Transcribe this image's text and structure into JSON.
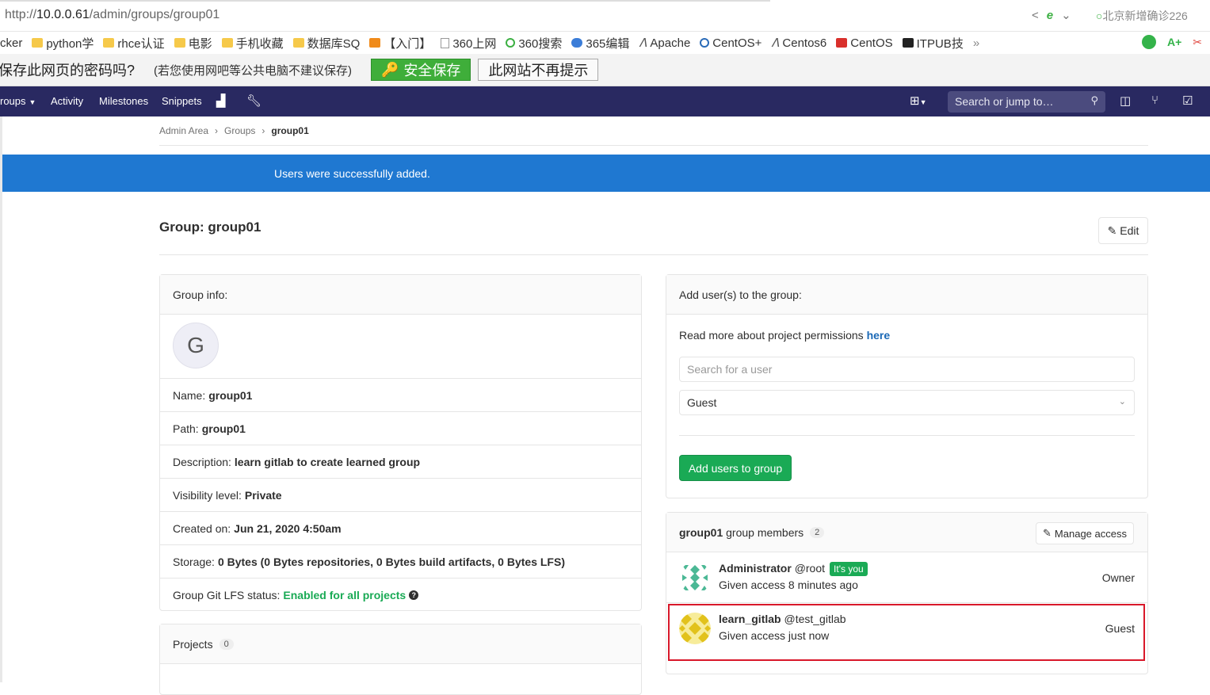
{
  "browser": {
    "url_prefix": "http://",
    "url_host": "10.0.0.61",
    "url_path": "/admin/groups/group01",
    "search_hint": "北京新增确诊226",
    "bookmarks": [
      {
        "icon": "folder-icon",
        "label": "cker"
      },
      {
        "icon": "folder-icon",
        "label": "python学"
      },
      {
        "icon": "folder-icon",
        "label": "rhce认证"
      },
      {
        "icon": "folder-icon",
        "label": "电影"
      },
      {
        "icon": "folder-icon",
        "label": "手机收藏"
      },
      {
        "icon": "folder-icon",
        "label": "数据库SQ"
      },
      {
        "icon": "orange-site-icon",
        "label": "【入门】"
      },
      {
        "icon": "document-icon",
        "label": "360上网"
      },
      {
        "icon": "360-icon",
        "label": "360搜索"
      },
      {
        "icon": "blue-site-icon",
        "label": "365编辑"
      },
      {
        "icon": "apache-icon",
        "label": "Apache"
      },
      {
        "icon": "centos-icon",
        "label": "CentOS+"
      },
      {
        "icon": "centos-icon",
        "label": "Centos6"
      },
      {
        "icon": "red-c-icon",
        "label": "CentOS"
      },
      {
        "icon": "itpub-icon",
        "label": "ITPUB技"
      }
    ],
    "more_label": "»"
  },
  "save_password": {
    "question": "保存此网页的密码吗?",
    "hint": "(若您使用网吧等公共电脑不建议保存)",
    "save_label": "安全保存",
    "never_label": "此网站不再提示"
  },
  "navbar": {
    "groups_label": "roups",
    "activity_label": "Activity",
    "milestones_label": "Milestones",
    "snippets_label": "Snippets",
    "search_placeholder": "Search or jump to…"
  },
  "breadcrumb": {
    "items": [
      "Admin Area",
      "Groups"
    ],
    "current": "group01"
  },
  "flash": {
    "message": "Users were successfully added.",
    "color": "#1f78d1"
  },
  "page": {
    "title": "Group: group01",
    "edit_label": "Edit"
  },
  "group_info": {
    "header": "Group info:",
    "avatar_letter": "G",
    "name_label": "Name:",
    "name_value": "group01",
    "path_label": "Path:",
    "path_value": "group01",
    "description_label": "Description:",
    "description_value": "learn gitlab to create learned group",
    "visibility_label": "Visibility level:",
    "visibility_value": "Private",
    "created_label": "Created on:",
    "created_value": "Jun 21, 2020 4:50am",
    "storage_label": "Storage:",
    "storage_value": "0 Bytes (0 Bytes repositories, 0 Bytes build artifacts, 0 Bytes LFS)",
    "lfs_label": "Group Git LFS status:",
    "lfs_value": "Enabled for all projects"
  },
  "projects": {
    "header": "Projects",
    "count": "0"
  },
  "add_users": {
    "header": "Add user(s) to the group:",
    "permissions_text": "Read more about project permissions",
    "permissions_link": "here",
    "search_placeholder": "Search for a user",
    "role_selected": "Guest",
    "submit_label": "Add users to group"
  },
  "members": {
    "group_name": "group01",
    "header_suffix": "group members",
    "count": "2",
    "manage_label": "Manage access",
    "list": [
      {
        "name": "Administrator",
        "username": "@root",
        "badge": "It's you",
        "access": "Given access 8 minutes ago",
        "role": "Owner"
      },
      {
        "name": "learn_gitlab",
        "username": "@test_gitlab",
        "badge": "",
        "access": "Given access just now",
        "role": "Guest"
      }
    ]
  }
}
